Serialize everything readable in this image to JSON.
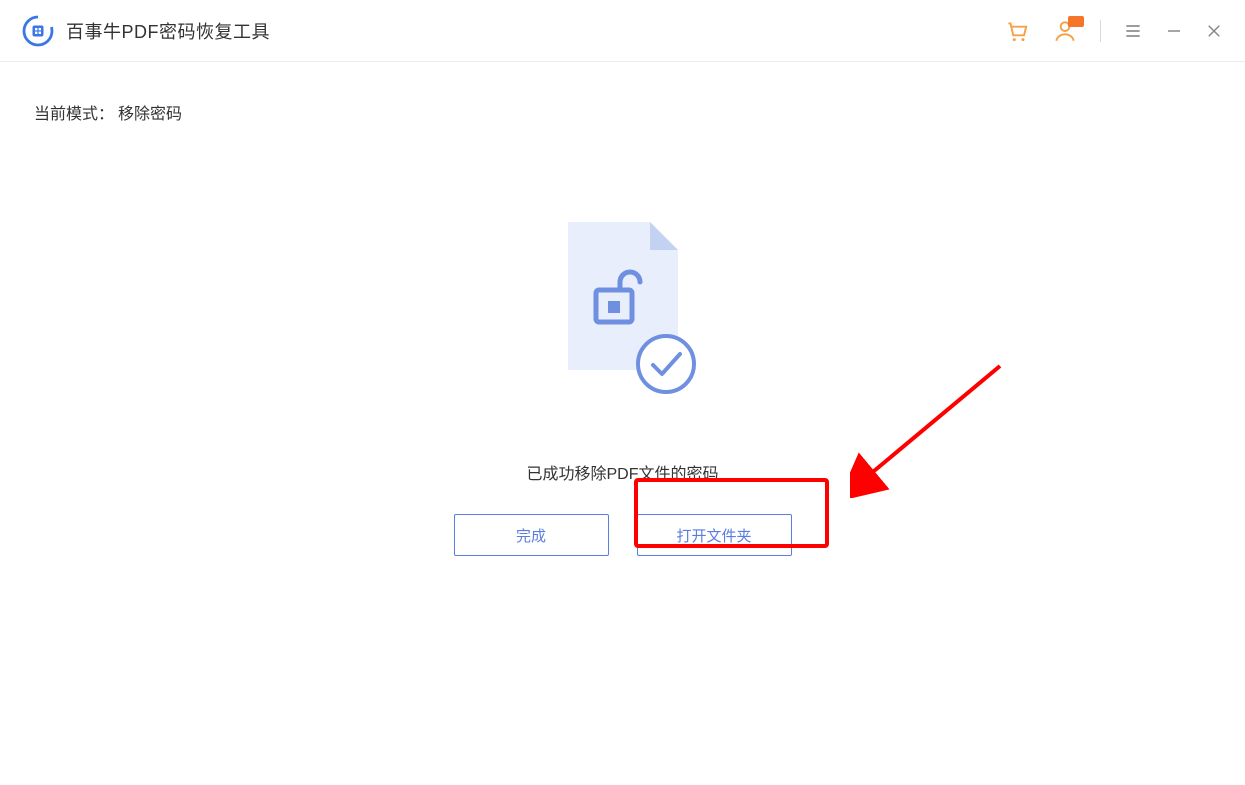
{
  "header": {
    "app_title": "百事牛PDF密码恢复工具"
  },
  "content": {
    "mode_label": "当前模式：",
    "mode_value": "移除密码",
    "status_text": "已成功移除PDF文件的密码",
    "buttons": {
      "done": "完成",
      "open_folder": "打开文件夹"
    }
  },
  "icons": {
    "cart": "cart-icon",
    "user": "user-icon",
    "menu": "menu-icon",
    "minimize": "minimize-icon",
    "close": "close-icon"
  }
}
